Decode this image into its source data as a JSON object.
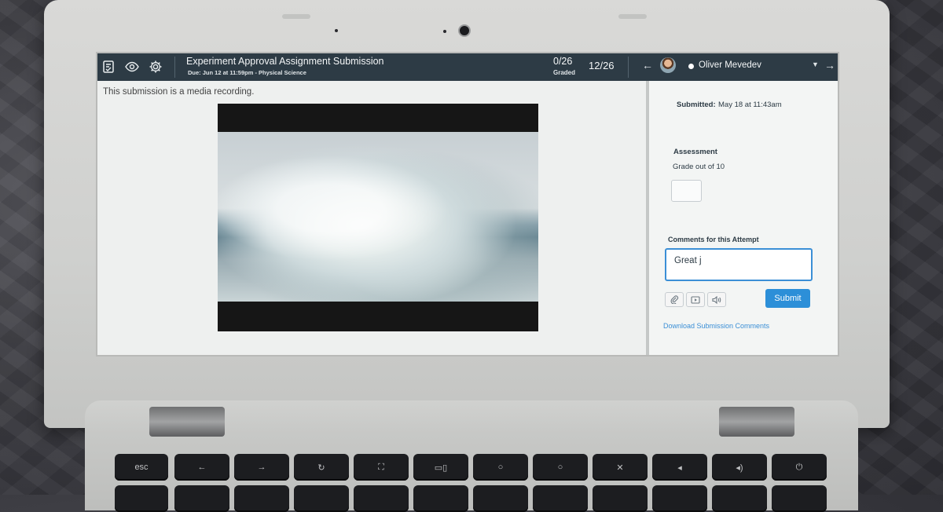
{
  "header": {
    "title": "Experiment Approval Assignment Submission",
    "due": "Due: Jun 12 at 11:59pm - Physical Science",
    "graded_count": "0/26",
    "graded_label": "Graded",
    "position": "12/26",
    "student_name": "Oliver Mevedev"
  },
  "content": {
    "notice": "This submission is a media recording."
  },
  "sidebar": {
    "submitted_label": "Submitted:",
    "submitted_value": "May 18 at 11:43am",
    "assessment_label": "Assessment",
    "grade_label": "Grade out of 10",
    "comments_label": "Comments for this Attempt",
    "comment_text": "Great j",
    "submit_label": "Submit",
    "download_link": "Download Submission Comments"
  },
  "keyboard": {
    "keys": [
      "esc",
      "←",
      "→",
      "↻",
      "⛶",
      "▭▯",
      "○",
      "○",
      "✕",
      "◂",
      "◂)",
      "⏻"
    ]
  }
}
